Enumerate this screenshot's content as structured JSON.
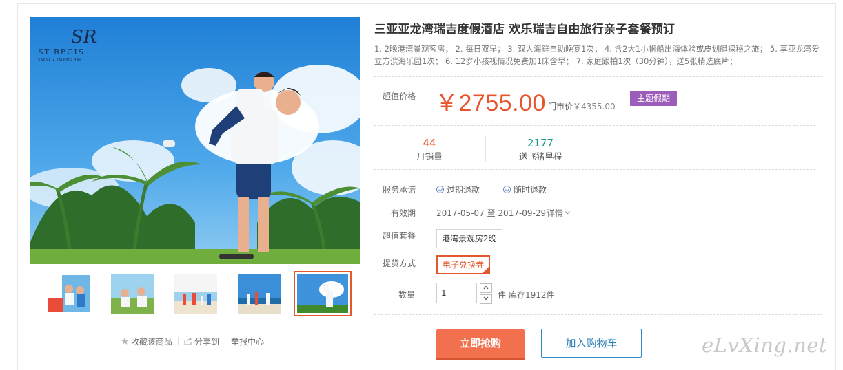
{
  "product": {
    "title": "三亚亚龙湾瑞吉度假酒店 欢乐瑞吉自由旅行亲子套餐预订",
    "description": "1. 2晚港湾景观客房；  2. 每日双早；  3. 双人海鲜自助晚宴1次；  4. 含2大1小帆船出海体验或皮划艇探秘之旅；  5. 享亚龙湾爱立方滨海乐园1次；  6. 12岁小孩视情况免费加1床含早；  7. 家庭跟拍1次（30分钟），送5张精选底片；"
  },
  "gallery": {
    "logo_name": "ST REGIS",
    "logo_sub": "SANYA • YALONG BAY",
    "thumbnail_count": 5,
    "active_thumbnail": 5
  },
  "gallery_actions": {
    "favorite": "收藏该商品",
    "share": "分享到",
    "report": "举报中心"
  },
  "pricing": {
    "label": "超值价格",
    "price": "￥2755.00",
    "market_label": "门市价",
    "market_price": "￥4355.00",
    "theme_tag": "主题假期"
  },
  "stats": {
    "monthly_sales": "44",
    "monthly_sales_label": "月销量",
    "miles": "2177",
    "miles_label": "送飞猪里程"
  },
  "details": {
    "service_label": "服务承诺",
    "service_1": "过期退款",
    "service_2": "随时退款",
    "validity_label": "有效期",
    "validity_start": "2017-05-07",
    "validity_to": "至",
    "validity_end": "2017-09-29",
    "details_link": "详情",
    "package_label": "超值套餐",
    "package_option": "港湾景观房2晚",
    "delivery_label": "提货方式",
    "delivery_option": "电子兑换券",
    "quantity_label": "数量",
    "quantity_value": "1",
    "quantity_unit": "件",
    "stock": "库存1912件"
  },
  "actions": {
    "buy_now": "立即抢购",
    "add_to_cart": "加入购物车"
  },
  "watermark": "eLvXing.net",
  "colors": {
    "price": "#e8542e",
    "tag": "#9c5dba",
    "miles": "#1e9a8a",
    "buy_button": "#f3704e",
    "cart_border": "#2d8ac4",
    "selected_border": "#e4582f"
  }
}
